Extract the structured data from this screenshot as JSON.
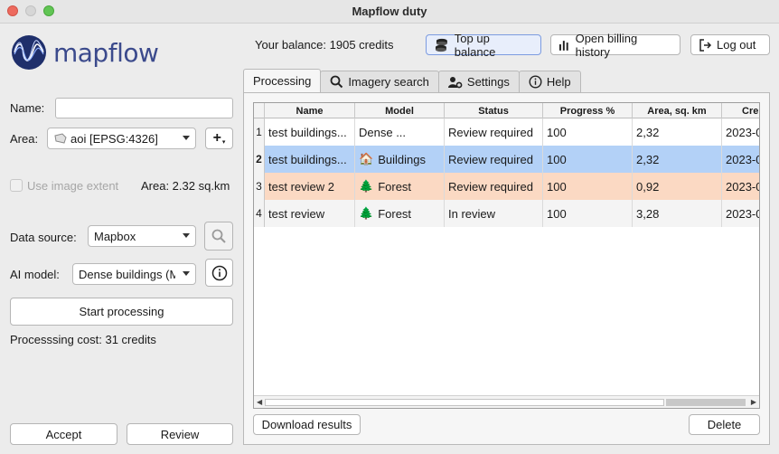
{
  "window": {
    "title": "Mapflow duty"
  },
  "logo": {
    "text": "mapflow"
  },
  "header": {
    "balance": "Your balance: 1905 credits",
    "top_up": "Top up balance",
    "billing": "Open billing history",
    "logout": "Log out"
  },
  "left": {
    "name_label": "Name:",
    "name_value": "",
    "area_label": "Area:",
    "area_value": "aoi [EPSG:4326]",
    "add_btn": "+",
    "use_extent": "Use image extent",
    "area_size": "Area: 2.32 sq.km",
    "source_label": "Data source:",
    "source_value": "Mapbox",
    "model_label": "AI model:",
    "model_value": "Dense buildings (M",
    "start": "Start processing",
    "cost": "Processsing cost: 31 credits",
    "accept": "Accept",
    "review": "Review"
  },
  "tabs": [
    {
      "label": "Processing",
      "icon": ""
    },
    {
      "label": "Imagery search",
      "icon": "search-icon"
    },
    {
      "label": "Settings",
      "icon": "settings-icon"
    },
    {
      "label": "Help",
      "icon": "info-icon"
    }
  ],
  "table": {
    "columns": [
      "Name",
      "Model",
      "Status",
      "Progress %",
      "Area, sq. km",
      "Cre"
    ],
    "rows": [
      {
        "num": "1",
        "name": "test buildings...",
        "model_icon": "",
        "model": "Dense ...",
        "status": "Review required",
        "progress": "100",
        "area": "2,32",
        "created": "2023-0"
      },
      {
        "num": "2",
        "name": "test buildings...",
        "model_icon": "🏠",
        "model": "Buildings",
        "status": "Review required",
        "progress": "100",
        "area": "2,32",
        "created": "2023-0"
      },
      {
        "num": "3",
        "name": "test review 2",
        "model_icon": "🌲",
        "model": "Forest",
        "status": "Review required",
        "progress": "100",
        "area": "0,92",
        "created": "2023-0"
      },
      {
        "num": "4",
        "name": "test review",
        "model_icon": "🌲",
        "model": "Forest",
        "status": "In review",
        "progress": "100",
        "area": "3,28",
        "created": "2023-0"
      }
    ]
  },
  "bottom": {
    "download": "Download results",
    "delete": "Delete"
  }
}
